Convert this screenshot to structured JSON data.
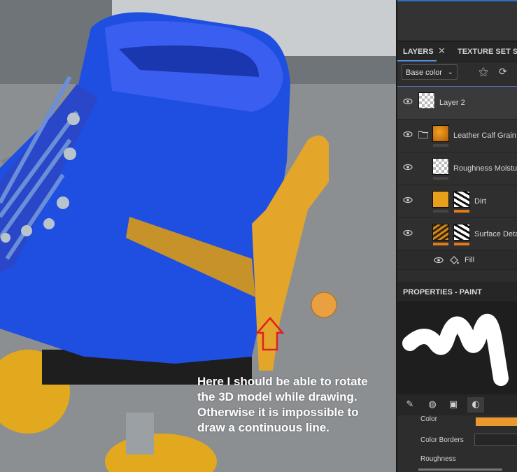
{
  "viewport": {
    "annotation_text": "Here I should be able to rotate the 3D model while drawing. Otherwise it is impossible to draw a continuous line.",
    "colors": {
      "boot": "#1f4fe0",
      "strap": "#e3a52a",
      "arrow": "#e02020",
      "cursor": "#e8a040"
    }
  },
  "panel": {
    "tabs": {
      "layers": "LAYERS",
      "close": "✕",
      "texture_set": "TEXTURE SET SE"
    },
    "channel_select": {
      "value": "Base color",
      "chevron": "⌄"
    },
    "tools": {
      "wand": "magic-wand-icon",
      "refresh": "refresh-icon"
    },
    "layers": [
      {
        "name": "Layer 2"
      },
      {
        "name": "Leather Calf Grain c"
      },
      {
        "name": "Roughness Moisture"
      },
      {
        "name": "Dirt"
      },
      {
        "name": "Surface Deta"
      }
    ],
    "fill_label": "Fill",
    "properties_title": "PROPERTIES - PAINT",
    "props": {
      "color": "Color",
      "color_borders": "Color Borders",
      "roughness": "Roughness"
    },
    "accent_color": "#e07a1a"
  }
}
